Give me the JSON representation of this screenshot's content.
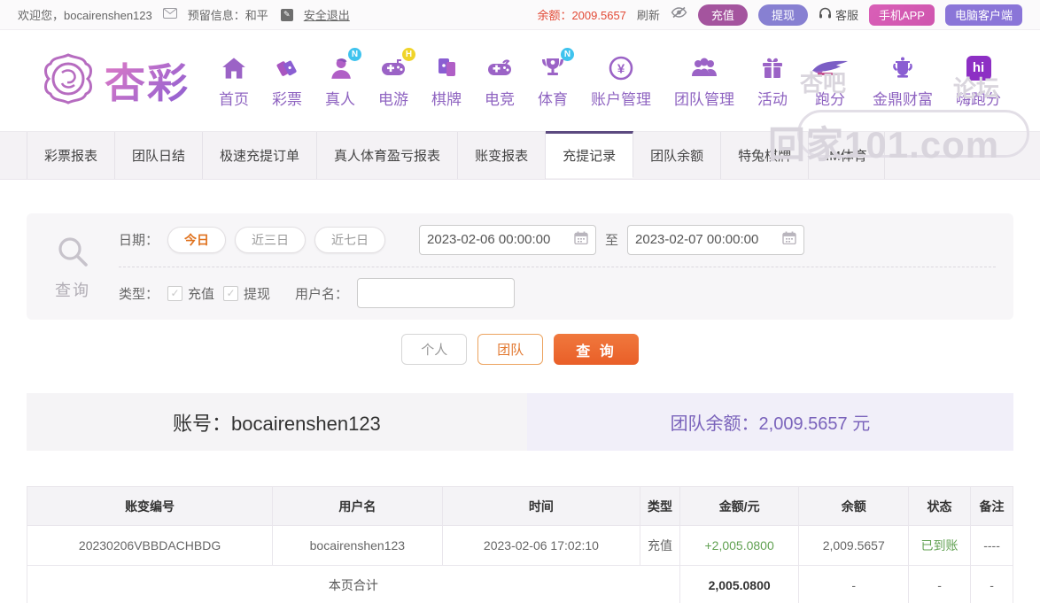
{
  "topbar": {
    "welcome": "欢迎您，bocairenshen123",
    "reserved_info": "预留信息：和平",
    "logout": "安全退出",
    "balance": "余额：2009.5657",
    "refresh": "刷新",
    "recharge": "充值",
    "withdraw": "提现",
    "service": "客服",
    "mobile_app": "手机APP",
    "pc_client": "电脑客户端"
  },
  "nav": {
    "logo_text": "杏彩",
    "items": [
      {
        "label": "首页",
        "icon": "home-icon"
      },
      {
        "label": "彩票",
        "icon": "ticket-icon"
      },
      {
        "label": "真人",
        "icon": "person-icon",
        "badge": "N"
      },
      {
        "label": "电游",
        "icon": "gamepad-icon",
        "badge": "H"
      },
      {
        "label": "棋牌",
        "icon": "cards-icon"
      },
      {
        "label": "电竞",
        "icon": "gamepad-icon"
      },
      {
        "label": "体育",
        "icon": "trophy-icon",
        "badge": "N"
      },
      {
        "label": "账户管理",
        "icon": "coin-icon"
      },
      {
        "label": "团队管理",
        "icon": "team-icon"
      },
      {
        "label": "活动",
        "icon": "gift-icon"
      },
      {
        "label": "跑分",
        "icon": "paofen-logo-icon"
      },
      {
        "label": "金鼎财富",
        "icon": "ding-icon"
      },
      {
        "label": "嗨跑分",
        "icon": "hi-app-icon"
      }
    ],
    "watermark": {
      "top_left": "杏吧",
      "top_right": "论坛",
      "main": "回家101.com"
    }
  },
  "tabs": {
    "items": [
      "彩票报表",
      "团队日结",
      "极速充提订单",
      "真人体育盈亏报表",
      "账变报表",
      "充提记录",
      "团队余额",
      "特兔棋牌",
      "IM体育"
    ],
    "active": "充提记录"
  },
  "filter": {
    "search_label": "查询",
    "date_label": "日期：",
    "quick_ranges": [
      "今日",
      "近三日",
      "近七日"
    ],
    "active_range": "今日",
    "date_from": "2023-02-06 00:00:00",
    "to_separator": "至",
    "date_to": "2023-02-07 00:00:00",
    "type_label": "类型：",
    "type_options": [
      "充值",
      "提现"
    ],
    "username_label": "用户名：",
    "username_value": ""
  },
  "actions": {
    "personal": "个人",
    "team": "团队",
    "query": "查 询"
  },
  "account": {
    "number": "账号：bocairenshen123",
    "team_balance": "团队余额：2,009.5657 元"
  },
  "table": {
    "headers": [
      "账变编号",
      "用户名",
      "时间",
      "类型",
      "金额/元",
      "余额",
      "状态",
      "备注"
    ],
    "rows": [
      {
        "cells": [
          "20230206VBBDACHBDG",
          "bocairenshen123",
          "2023-02-06 17:02:10",
          "充值",
          "+2,005.0800",
          "2,009.5657",
          "已到账",
          "----"
        ]
      }
    ],
    "summary": {
      "label": "本页合计",
      "amount": "2,005.0800",
      "balance": "-",
      "status": "-",
      "note": "-"
    }
  },
  "colors": {
    "accent_purple": "#8f64c1",
    "active_tab_border": "#5c4a80",
    "balance_red": "#e24a36",
    "query_orange": "#ed6a35",
    "green": "#61a152",
    "recharge_bg": "#a4549e",
    "withdraw_bg": "#8780d2",
    "mobile_bg": "#d95fb7",
    "pc_bg": "#8a75d8"
  }
}
